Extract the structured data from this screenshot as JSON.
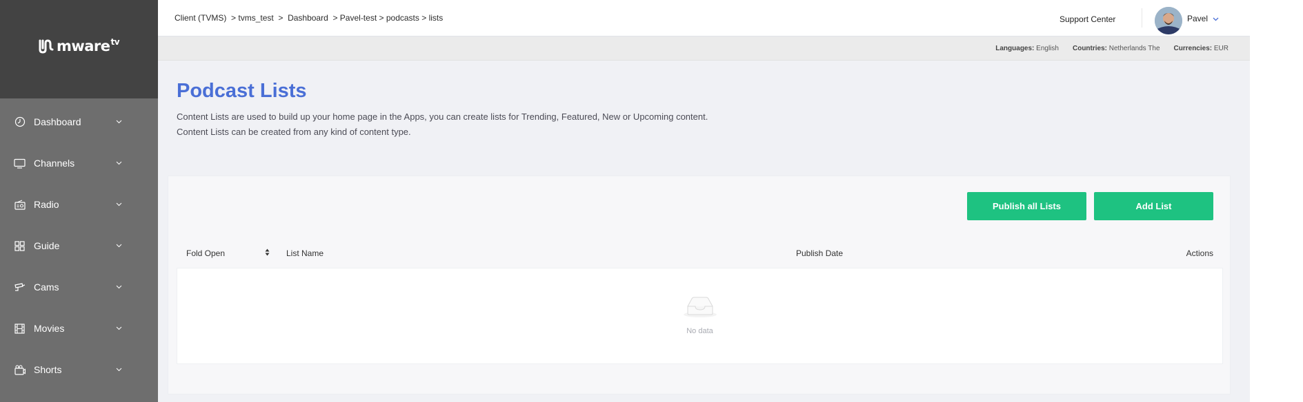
{
  "sidebar": {
    "logo": {
      "text": "mware",
      "sup": "tv"
    },
    "items": [
      {
        "label": "Dashboard",
        "icon": "dashboard-gauge-icon"
      },
      {
        "label": "Channels",
        "icon": "tv-monitor-icon"
      },
      {
        "label": "Radio",
        "icon": "radio-icon"
      },
      {
        "label": "Guide",
        "icon": "grid-guide-icon"
      },
      {
        "label": "Cams",
        "icon": "camera-icon"
      },
      {
        "label": "Movies",
        "icon": "film-icon"
      },
      {
        "label": "Shorts",
        "icon": "video-clip-icon"
      }
    ]
  },
  "topbar": {
    "breadcrumb": [
      "Client (TVMS)",
      "tvms_test",
      "Dashboard",
      "Pavel-test",
      "podcasts",
      "lists"
    ],
    "support_label": "Support Center",
    "user_name": "Pavel"
  },
  "subbar": {
    "languages_label": "Languages:",
    "languages_value": "English",
    "countries_label": "Countries:",
    "countries_value": "Netherlands The",
    "currencies_label": "Currencies:",
    "currencies_value": "EUR"
  },
  "page": {
    "title": "Podcast Lists",
    "description": "Content Lists are used to build up your home page in the Apps, you can create lists for Trending, Featured, New or Upcoming content. Content Lists can be created from any kind of content type."
  },
  "actions": {
    "publish_all": "Publish all Lists",
    "add_list": "Add List"
  },
  "table": {
    "columns": [
      "Fold Open",
      "List Name",
      "Publish Date",
      "Actions"
    ],
    "empty_text": "No data"
  },
  "colors": {
    "accent": "#4a6fd6",
    "button": "#1ec281",
    "sidebar": "#6e6e6e",
    "sidebar_header": "#434343"
  }
}
